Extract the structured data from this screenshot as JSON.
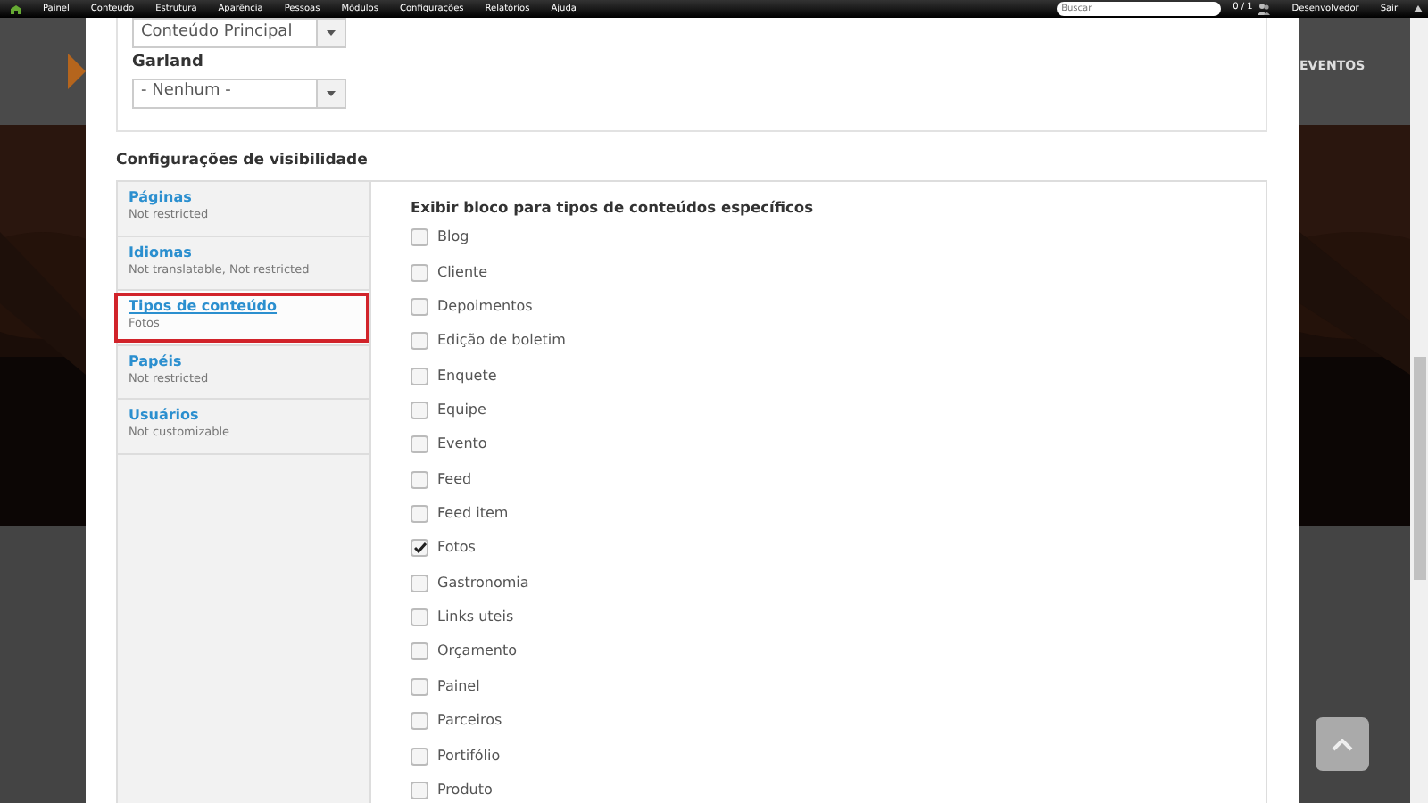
{
  "toolbar": {
    "menu": [
      "Painel",
      "Conteúdo",
      "Estrutura",
      "Aparência",
      "Pessoas",
      "Módulos",
      "Configurações",
      "Relatórios",
      "Ajuda"
    ],
    "search": {
      "placeholder": "Buscar"
    },
    "counter": "0 / 1",
    "user": "Desenvolvedor",
    "logout": "Sair"
  },
  "background": {
    "nav_label": "EVENTOS"
  },
  "form": {
    "fields": [
      {
        "value": "Conteúdo Principal"
      },
      {
        "label": "Garland",
        "value": "- Nenhum -"
      }
    ]
  },
  "visibility": {
    "title": "Configurações de visibilidade",
    "tabs": [
      {
        "title": "Páginas",
        "summary": "Not restricted",
        "selected": false,
        "highlighted": false
      },
      {
        "title": "Idiomas",
        "summary": "Not translatable, Not restricted",
        "selected": false,
        "highlighted": false
      },
      {
        "title": "Tipos de conteúdo",
        "summary": "Fotos",
        "selected": true,
        "highlighted": true
      },
      {
        "title": "Papéis",
        "summary": "Not restricted",
        "selected": false,
        "highlighted": false
      },
      {
        "title": "Usuários",
        "summary": "Not customizable",
        "selected": false,
        "highlighted": false
      }
    ],
    "pane": {
      "heading": "Exibir bloco para tipos de conteúdos específicos",
      "options": [
        {
          "label": "Blog",
          "checked": false
        },
        {
          "label": "Cliente",
          "checked": false
        },
        {
          "label": "Depoimentos",
          "checked": false
        },
        {
          "label": "Edição de boletim",
          "checked": false
        },
        {
          "label": "Enquete",
          "checked": false
        },
        {
          "label": "Equipe",
          "checked": false
        },
        {
          "label": "Evento",
          "checked": false
        },
        {
          "label": "Feed",
          "checked": false
        },
        {
          "label": "Feed item",
          "checked": false
        },
        {
          "label": "Fotos",
          "checked": true
        },
        {
          "label": "Gastronomia",
          "checked": false
        },
        {
          "label": "Links uteis",
          "checked": false
        },
        {
          "label": "Orçamento",
          "checked": false
        },
        {
          "label": "Painel",
          "checked": false
        },
        {
          "label": "Parceiros",
          "checked": false
        },
        {
          "label": "Portifólio",
          "checked": false
        },
        {
          "label": "Produto",
          "checked": false
        }
      ]
    }
  }
}
